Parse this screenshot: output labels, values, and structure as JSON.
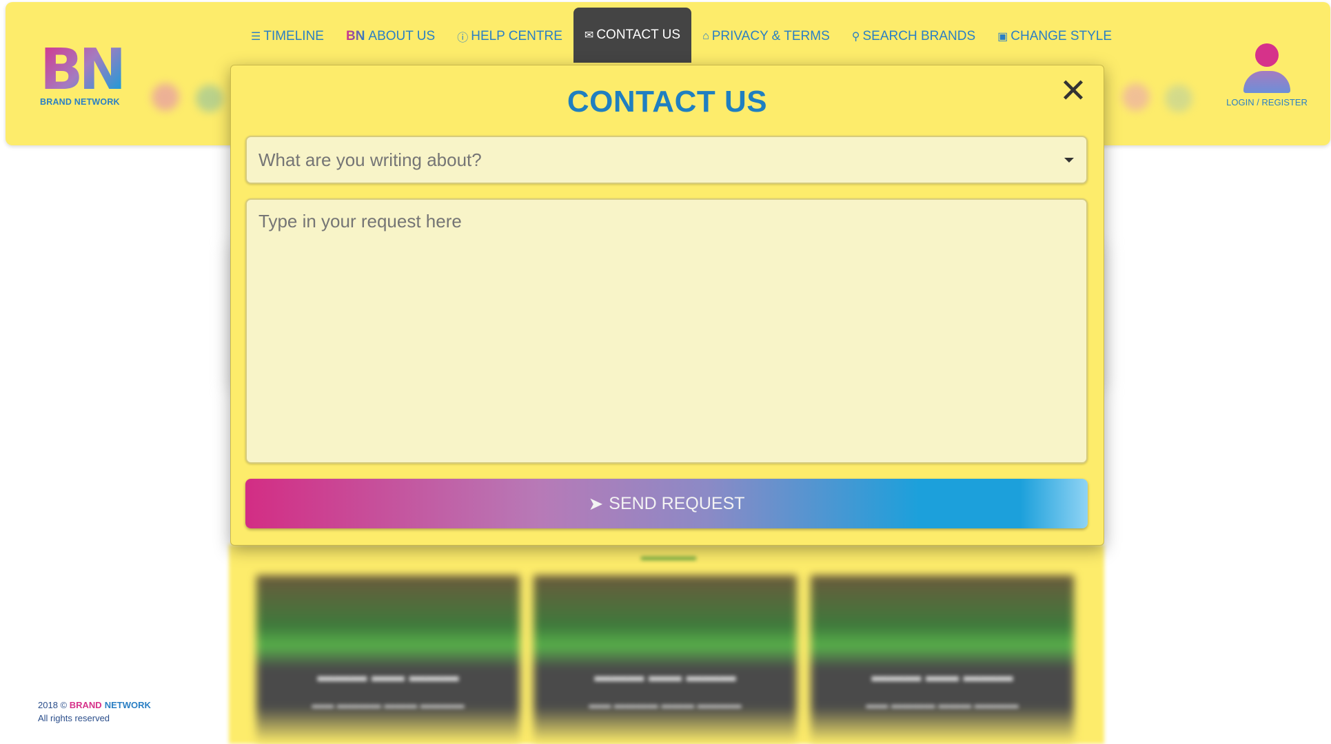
{
  "brand": {
    "logo_letters": "BN",
    "logo_subtitle": "BRAND NETWORK",
    "colors": {
      "pink": "#d6328a",
      "blue": "#2a7fc4",
      "yellow": "#fdec6b",
      "dark": "#444444"
    }
  },
  "nav": {
    "items": [
      {
        "label": "TIMELINE",
        "icon": "list-icon"
      },
      {
        "label": "ABOUT US",
        "icon": "bn-icon",
        "icon_text": "BN"
      },
      {
        "label": "HELP CENTRE",
        "icon": "help-icon"
      },
      {
        "label": "CONTACT US",
        "icon": "mail-icon",
        "active": true
      },
      {
        "label": "PRIVACY & TERMS",
        "icon": "bank-icon"
      },
      {
        "label": "SEARCH BRANDS",
        "icon": "search-icon"
      },
      {
        "label": "CHANGE STYLE",
        "icon": "palette-icon"
      }
    ]
  },
  "user": {
    "login_label": "LOGIN / REGISTER",
    "icon": "user-icon"
  },
  "modal": {
    "title": "CONTACT US",
    "close_icon": "close-icon",
    "subject_placeholder": "What are you writing about?",
    "request_placeholder": "Type in your request here",
    "send_label": "SEND REQUEST",
    "send_icon": "send-icon"
  },
  "footer": {
    "year_prefix": "2018 ©",
    "brand_word1": "BRAND",
    "brand_word2": "NETWORK",
    "rights": "All rights reserved"
  }
}
